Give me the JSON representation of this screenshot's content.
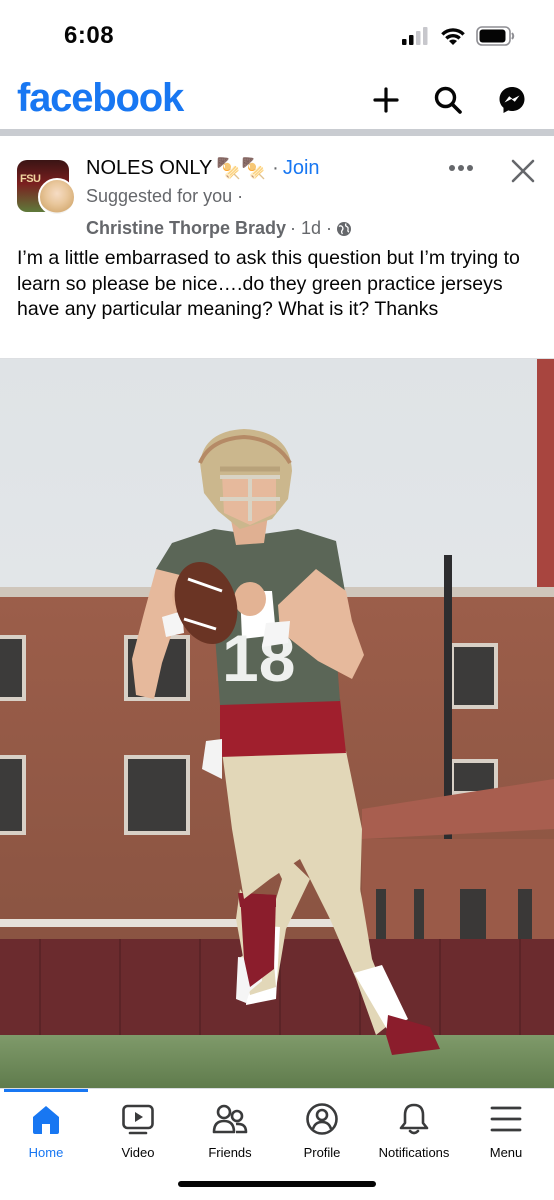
{
  "status_bar": {
    "time": "6:08",
    "icons": [
      "cellular-signal-icon",
      "wifi-icon",
      "battery-icon"
    ]
  },
  "header": {
    "logo": "facebook",
    "brand_color": "#1877f2",
    "actions": [
      "add-icon",
      "search-icon",
      "messenger-icon"
    ]
  },
  "post": {
    "group_avatar_text": "FSU",
    "group_name": "NOLES ONLY",
    "group_emoji": "🍢🍢",
    "separator": "·",
    "join_label": "Join",
    "suggested_label": "Suggested for you ·",
    "author": "Christine Thorpe Brady",
    "time": "· 1d ·",
    "privacy_icon": "globe-icon",
    "text": "I’m a little embarrased to ask this question but I’m trying to learn so please be nice….do they green practice jerseys have any particular meaning?  What is it?  Thanks",
    "photo": {
      "description_icon": "football-player-photo",
      "jersey_number": "18"
    }
  },
  "bottom_nav": {
    "items": [
      {
        "label": "Home",
        "icon": "home-icon",
        "active": true
      },
      {
        "label": "Video",
        "icon": "video-icon",
        "active": false
      },
      {
        "label": "Friends",
        "icon": "friends-icon",
        "active": false
      },
      {
        "label": "Profile",
        "icon": "profile-icon",
        "active": false
      },
      {
        "label": "Notifications",
        "icon": "bell-icon",
        "active": false
      },
      {
        "label": "Menu",
        "icon": "menu-icon",
        "active": false
      }
    ]
  }
}
